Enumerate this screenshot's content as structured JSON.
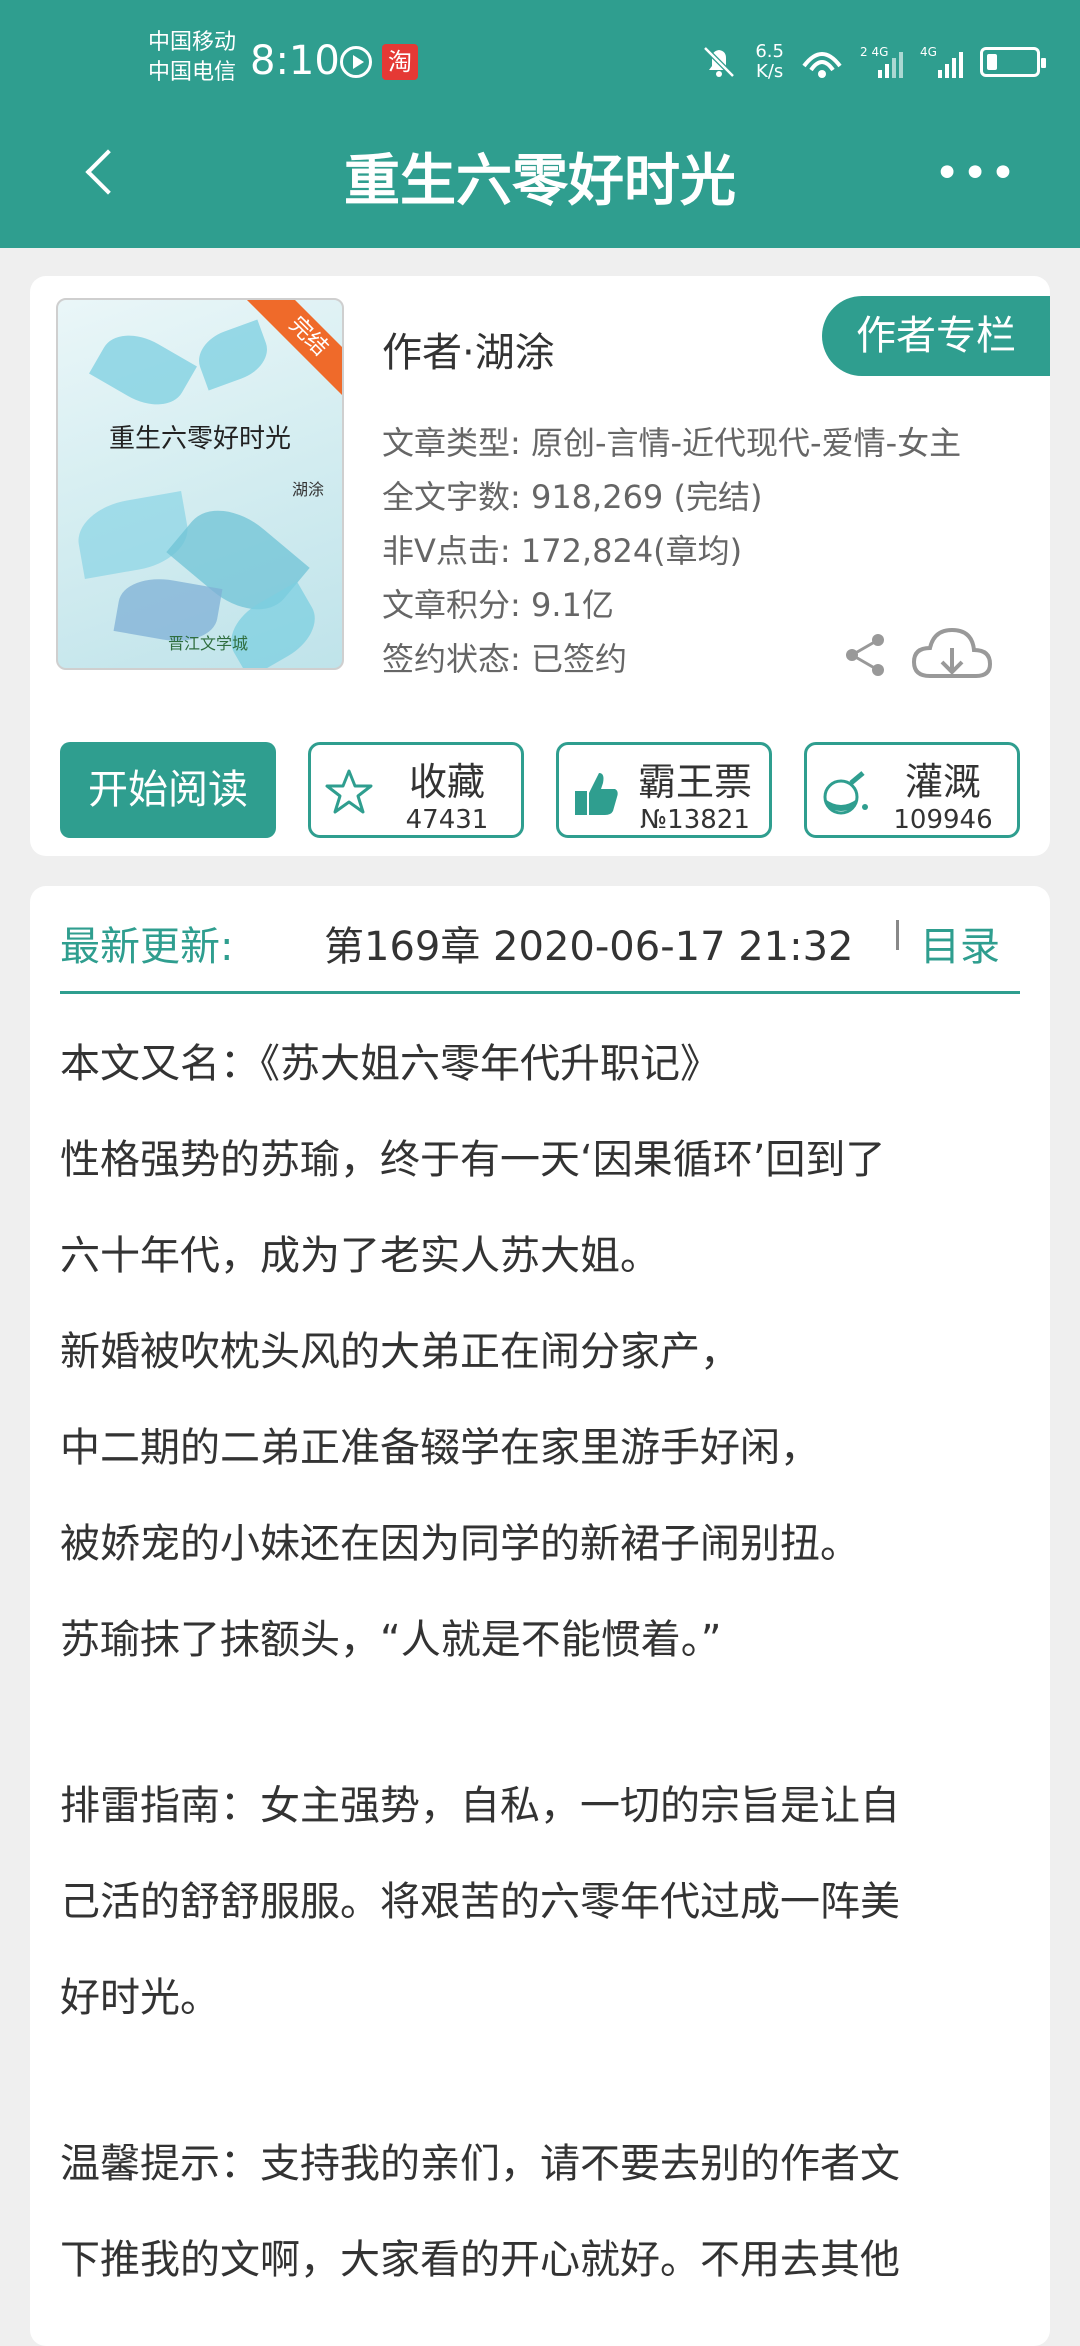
{
  "status_bar": {
    "carrier1": "中国移动",
    "carrier2": "中国电信",
    "time": "8:10",
    "speed_value": "6.5",
    "speed_unit": "K/s"
  },
  "nav": {
    "title": "重生六零好时光"
  },
  "book": {
    "cover_title": "重生六零好时光",
    "cover_author": "湖涂",
    "cover_badge": "完结",
    "cover_logo": "晋江文学城",
    "author": "作者·湖涂",
    "author_column": "作者专栏",
    "meta": [
      "文章类型: 原创-言情-近代现代-爱情-女主",
      "全文字数: 918,269 (完结)",
      "非Ⅴ点击: 172,824(章均)",
      "文章积分: 9.1亿",
      "签约状态: 已签约"
    ]
  },
  "actions": {
    "start_read": "开始阅读",
    "collect": {
      "label": "收藏",
      "count": "47431"
    },
    "ticket": {
      "label": "霸王票",
      "count": "№13821"
    },
    "irrigate": {
      "label": "灌溉",
      "count": "109946"
    }
  },
  "latest": {
    "label": "最新更新:",
    "value": "第169章  2020-06-17 21:32",
    "toc": "目录"
  },
  "description": [
    "本文又名：《苏大姐六零年代升职记》",
    "性格强势的苏瑜，终于有一天‘因果循环’回到了",
    "六十年代，成为了老实人苏大姐。",
    "新婚被吹枕头风的大弟正在闹分家产，",
    "中二期的二弟正准备辍学在家里游手好闲，",
    "被娇宠的小妹还在因为同学的新裙子闹别扭。",
    "苏瑜抹了抹额头，“人就是不能惯着。”",
    "",
    "排雷指南：女主强势，自私，一切的宗旨是让自",
    "己活的舒舒服服。将艰苦的六零年代过成一阵美",
    "好时光。",
    "",
    "温馨提示：支持我的亲们，请不要去别的作者文",
    "下推我的文啊，大家看的开心就好。不用去其他"
  ],
  "colors": {
    "accent": "#2f9e8f",
    "badge": "#ef6a2a"
  }
}
